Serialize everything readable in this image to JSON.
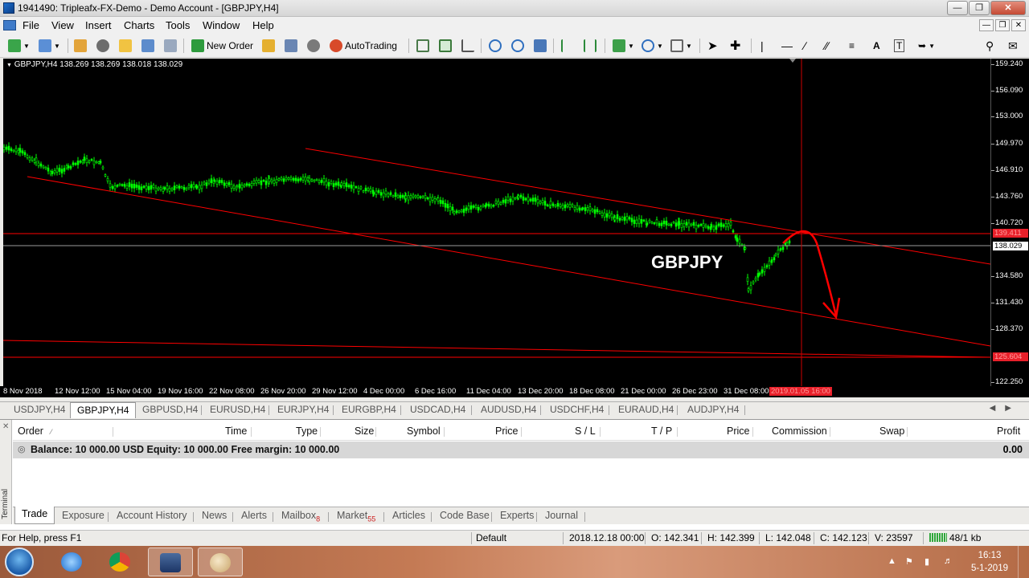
{
  "window": {
    "title": "1941490: Tripleafx-FX-Demo - Demo Account - [GBPJPY,H4]"
  },
  "menu": [
    "File",
    "View",
    "Insert",
    "Charts",
    "Tools",
    "Window",
    "Help"
  ],
  "toolbar": {
    "new_order": "New Order",
    "autotrading": "AutoTrading"
  },
  "chart": {
    "info": "GBPJPY,H4  138.269 138.269 138.018 138.029",
    "watermark": "GBPJPY",
    "price_ticks": [
      "159.240",
      "156.090",
      "153.000",
      "149.970",
      "146.910",
      "143.760",
      "140.720",
      "138.029",
      "134.580",
      "131.430",
      "128.370",
      "125.604",
      "122.250"
    ],
    "price_label_hline": "139.411",
    "price_label_current": "138.029",
    "price_label_bottom": "125.604",
    "time_ticks": [
      "8 Nov 2018",
      "12 Nov 12:00",
      "15 Nov 04:00",
      "19 Nov 16:00",
      "22 Nov 08:00",
      "26 Nov 20:00",
      "29 Nov 12:00",
      "4 Dec 00:00",
      "6 Dec 16:00",
      "11 Dec 04:00",
      "13 Dec 20:00",
      "18 Dec 08:00",
      "21 Dec 00:00",
      "26 Dec 23:00",
      "31 Dec 08:00"
    ],
    "time_highlight": "2019.01.05 16:00",
    "colors": {
      "candles": "#00ff00",
      "lines": "#ff0000",
      "crosshair": "#cc0000",
      "background": "#000000"
    }
  },
  "chart_tabs": [
    "USDJPY,H4",
    "GBPJPY,H4",
    "GBPUSD,H4",
    "EURUSD,H4",
    "EURJPY,H4",
    "EURGBP,H4",
    "USDCAD,H4",
    "AUDUSD,H4",
    "USDCHF,H4",
    "EURAUD,H4",
    "AUDJPY,H4"
  ],
  "active_chart_tab": "GBPJPY,H4",
  "terminal": {
    "side_label": "Terminal",
    "columns": [
      "Order",
      "Time",
      "Type",
      "Size",
      "Symbol",
      "Price",
      "S / L",
      "T / P",
      "Price",
      "Commission",
      "Swap",
      "Profit"
    ],
    "balance_text": "Balance: 10 000.00 USD  Equity: 10 000.00  Free margin: 10 000.00",
    "balance_profit": "0.00",
    "tabs": [
      {
        "label": "Trade",
        "badge": ""
      },
      {
        "label": "Exposure",
        "badge": ""
      },
      {
        "label": "Account History",
        "badge": ""
      },
      {
        "label": "News",
        "badge": ""
      },
      {
        "label": "Alerts",
        "badge": ""
      },
      {
        "label": "Mailbox",
        "badge": "8"
      },
      {
        "label": "Market",
        "badge": "55"
      },
      {
        "label": "Articles",
        "badge": ""
      },
      {
        "label": "Code Base",
        "badge": ""
      },
      {
        "label": "Experts",
        "badge": ""
      },
      {
        "label": "Journal",
        "badge": ""
      }
    ]
  },
  "status": {
    "help": "For Help, press F1",
    "profile": "Default",
    "datetime": "2018.12.18 00:00",
    "open": "O: 142.341",
    "high": "H: 142.399",
    "low": "L: 142.048",
    "close": "C: 142.123",
    "volume": "V: 23597",
    "traffic": "48/1 kb"
  },
  "taskbar": {
    "apps": [
      "start-orb",
      "internet-explorer",
      "chrome",
      "aaafx-terminal",
      "paint"
    ],
    "clock_time": "16:13",
    "clock_date": "5-1-2019"
  }
}
